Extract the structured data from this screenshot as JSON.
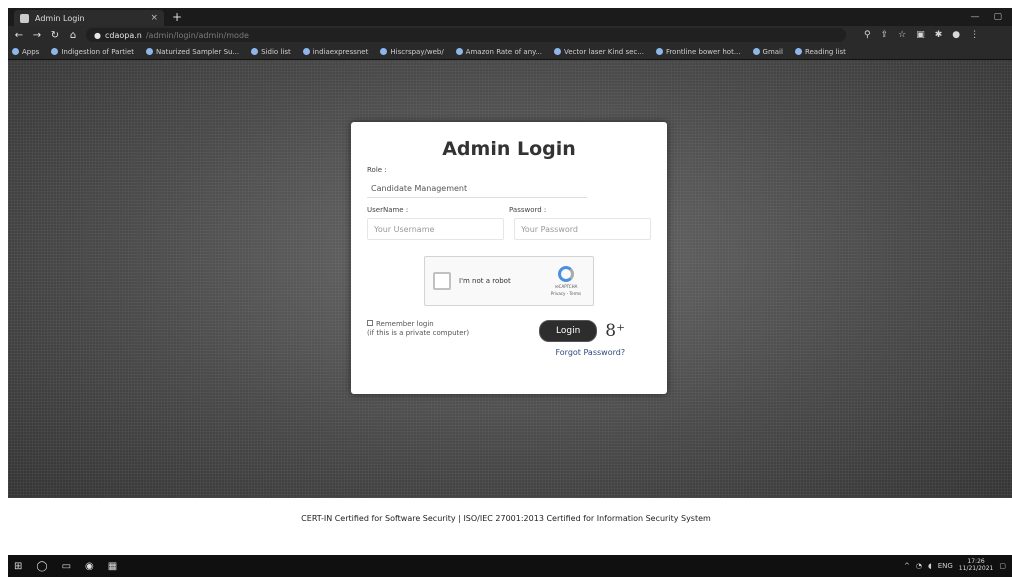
{
  "browser": {
    "tab_title": "Admin Login",
    "tab_close": "×",
    "new_tab": "+",
    "url_host": "cdaopa.n",
    "url_path": "/admin/login/admin/mode",
    "bookmarks": [
      "Apps",
      "Indigestion of Partiet",
      "Naturized Sampler Su...",
      "Sidio list",
      "indiaexpressnet",
      "Hiscrspay/web/",
      "Amazon Rate of any...",
      "Vector laser Kind sec...",
      "Frontline bower hot...",
      "Gmail",
      "Reading list"
    ]
  },
  "login": {
    "title": "Admin Login",
    "role_label": "Role :",
    "role_value": "Candidate Management",
    "username_label": "UserName :",
    "password_label": "Password :",
    "username_placeholder": "Your Username",
    "password_placeholder": "Your Password",
    "captcha_text": "I'm not a robot",
    "captcha_brand": "reCAPTCHA",
    "captcha_links": "Privacy - Terms",
    "remember_line1": "Remember login",
    "remember_line2": "(if this is a private computer)",
    "login_button": "Login",
    "gplus": "8⁺",
    "forgot": "Forgot Password?"
  },
  "footer": {
    "text": "CERT-IN Certified for Software Security | ISO/IEC 27001:2013 Certified for Information Security System"
  },
  "taskbar": {
    "tray_text": "ENG",
    "time": "17:26",
    "date": "11/21/2021"
  }
}
